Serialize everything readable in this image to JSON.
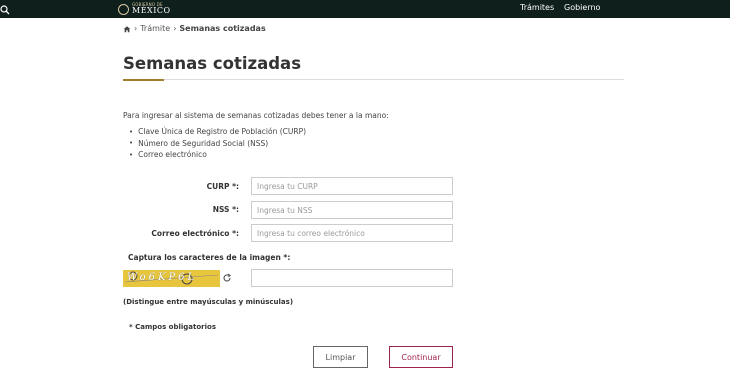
{
  "header": {
    "logo_small": "GOBIERNO DE",
    "logo_big": "MÉXICO",
    "nav": [
      "Trámites",
      "Gobierno"
    ],
    "search_icon": "search-icon"
  },
  "breadcrumb": {
    "home_icon": "home-icon",
    "items": [
      "Trámite",
      "Semanas cotizadas"
    ]
  },
  "page": {
    "title": "Semanas cotizadas",
    "intro": "Para ingresar al sistema de semanas cotizadas debes tener a la mano:",
    "requirements": [
      "Clave Única de Registro de Población (CURP)",
      "Número de Seguridad Social (NSS)",
      "Correo electrónico"
    ]
  },
  "form": {
    "curp_label": "CURP *:",
    "curp_placeholder": "Ingresa tu CURP",
    "curp_value": "",
    "nss_label": "NSS *:",
    "nss_placeholder": "Ingresa tu NSS",
    "nss_value": "",
    "email_label": "Correo electrónico *:",
    "email_placeholder": "Ingresa tu correo electrónico",
    "email_value": "",
    "captcha_label": "Captura los caracteres de la imagen *:",
    "captcha_text": "Wo6KP6L",
    "captcha_value": "",
    "case_note": "(Distingue entre mayúsculas y minúsculas)",
    "required_note": "* Campos obligatorios",
    "clear_label": "Limpiar",
    "continue_label": "Continuar"
  },
  "colors": {
    "topbar": "#0f1f1b",
    "accent_gold": "#a57f2c",
    "primary_button": "#9d2449",
    "captcha_bg": "#e7c53c"
  }
}
